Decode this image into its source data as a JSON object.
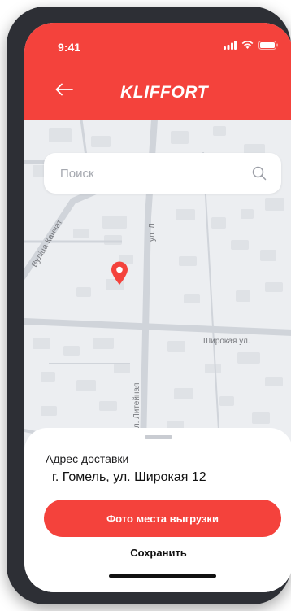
{
  "status_bar": {
    "time": "9:41"
  },
  "header": {
    "back_icon": "arrow-left-icon",
    "brand": "KLIFFORT"
  },
  "search": {
    "placeholder": "Поиск",
    "icon": "search-icon"
  },
  "map": {
    "street_labels": [
      "Вуліца Канчат",
      "ул. Л",
      "Широкая ул.",
      "ул. Литейная"
    ],
    "pin_icon": "location-pin-icon"
  },
  "sheet": {
    "address_label": "Адрес доставки",
    "address_value": "г. Гомель, ул. Широкая 12",
    "photo_button": "Фото места выгрузки",
    "save_link": "Сохранить"
  },
  "colors": {
    "accent": "#f4423c",
    "map_bg": "#eceef1"
  }
}
